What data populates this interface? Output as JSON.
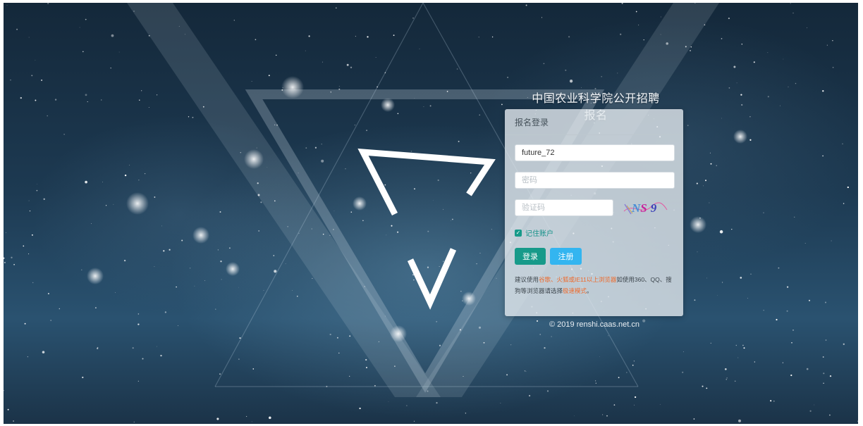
{
  "site": {
    "title": "中国农业科学院公开招聘报名",
    "copyright": "© 2019 renshi.caas.net.cn"
  },
  "login": {
    "heading": "报名登录",
    "username_value": "future_72",
    "password_placeholder": "密码",
    "captcha_placeholder": "验证码",
    "captcha_text": "NS9",
    "remember_label": "记住账户",
    "remember_checked": true,
    "login_button": "登录",
    "register_button": "注册"
  },
  "notice": {
    "part1": "建议使用",
    "part2": "谷歌、火狐或IE11以上浏览器",
    "part3": "如使用360、QQ、搜狗等浏览器请选择",
    "part4": "极速模式",
    "part5": "。"
  },
  "colors": {
    "primary": "#179a8a",
    "secondary": "#33b5f0",
    "highlight": "#ee6a2c"
  }
}
